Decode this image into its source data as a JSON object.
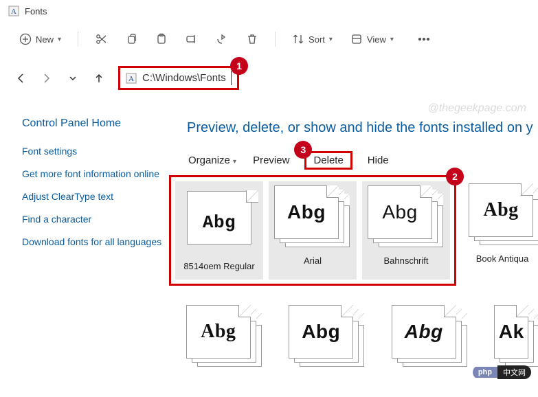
{
  "title": "Fonts",
  "toolbar": {
    "new_label": "New",
    "sort_label": "Sort",
    "view_label": "View"
  },
  "address": "C:\\Windows\\Fonts",
  "watermark": "@thegeekpage.com",
  "sidebar": {
    "home": "Control Panel Home",
    "items": [
      "Font settings",
      "Get more font information online",
      "Adjust ClearType text",
      "Find a character",
      "Download fonts for all languages"
    ]
  },
  "heading": "Preview, delete, or show and hide the fonts installed on y",
  "actions": {
    "organize": "Organize",
    "preview": "Preview",
    "delete": "Delete",
    "hide": "Hide"
  },
  "fonts_row1": [
    {
      "name": "8514oem Regular",
      "sample": "Abg",
      "stack": false,
      "pixel": true
    },
    {
      "name": "Arial",
      "sample": "Abg",
      "stack": true,
      "pixel": false
    },
    {
      "name": "Bahnschrift",
      "sample": "Abg",
      "stack": true,
      "pixel": false
    }
  ],
  "font_extra": {
    "name": "Book Antiqua",
    "sample": "Abg"
  },
  "fonts_row2": [
    {
      "sample": "Abg"
    },
    {
      "sample": "Abg"
    },
    {
      "sample": "Abg"
    },
    {
      "sample": "Ak"
    }
  ],
  "badges": {
    "b1": "1",
    "b2": "2",
    "b3": "3"
  },
  "chip": {
    "left": "php",
    "right": "中文网"
  }
}
